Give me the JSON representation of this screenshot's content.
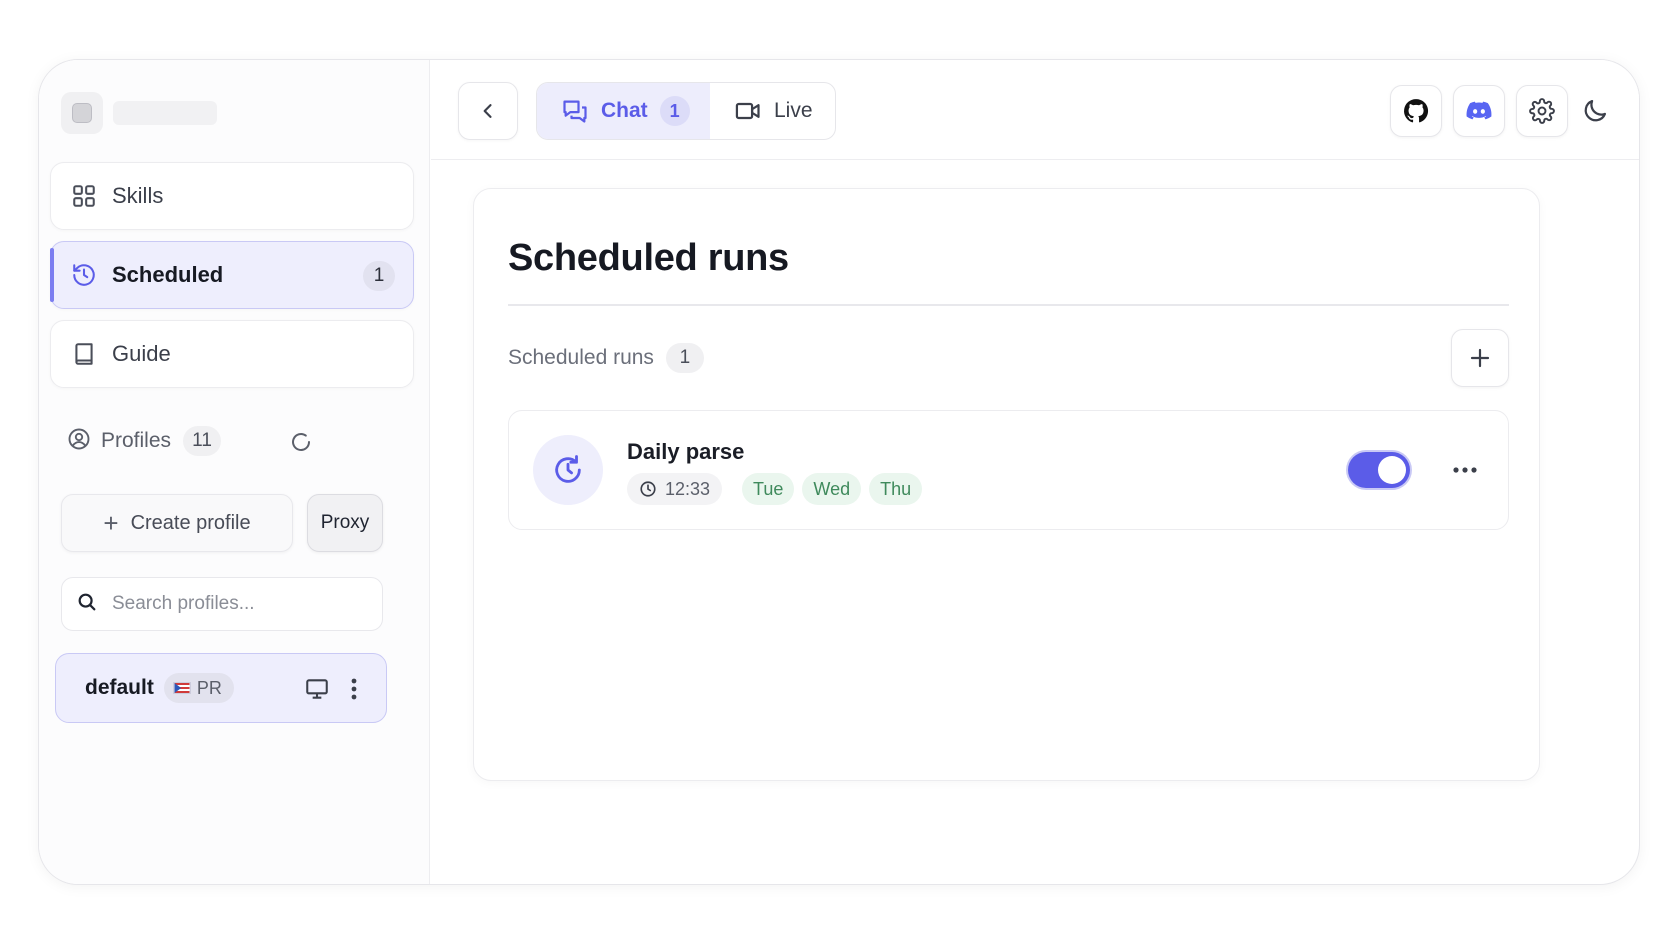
{
  "sidebar": {
    "nav": [
      {
        "label": "Skills"
      },
      {
        "label": "Scheduled",
        "badge": "1"
      },
      {
        "label": "Guide"
      }
    ],
    "profiles": {
      "label": "Profiles",
      "count": "11",
      "create_label": "Create profile",
      "proxy_label": "Proxy",
      "search_placeholder": "Search profiles...",
      "items": [
        {
          "name": "default",
          "region": "PR"
        }
      ]
    }
  },
  "topbar": {
    "tabs": [
      {
        "label": "Chat",
        "badge": "1"
      },
      {
        "label": "Live"
      }
    ]
  },
  "main": {
    "title": "Scheduled runs",
    "section_label": "Scheduled runs",
    "section_count": "1",
    "runs": [
      {
        "name": "Daily parse",
        "time": "12:33",
        "days": [
          "Tue",
          "Wed",
          "Thu"
        ],
        "enabled": true
      }
    ]
  },
  "colors": {
    "accent": "#5b5ce8",
    "accent_soft": "#eeeefd",
    "day_pill_bg": "#eaf6ee",
    "day_pill_text": "#3f8a5c"
  },
  "icons": {
    "skills": "grid-icon",
    "scheduled": "history-icon",
    "guide": "book-icon",
    "profiles": "user-circle-icon",
    "refresh": "refresh-icon",
    "back": "chevron-left-icon",
    "chat": "chat-bubbles-icon",
    "live": "video-camera-icon",
    "github": "github-icon",
    "discord": "discord-icon",
    "settings": "gear-icon",
    "theme": "moon-icon"
  }
}
